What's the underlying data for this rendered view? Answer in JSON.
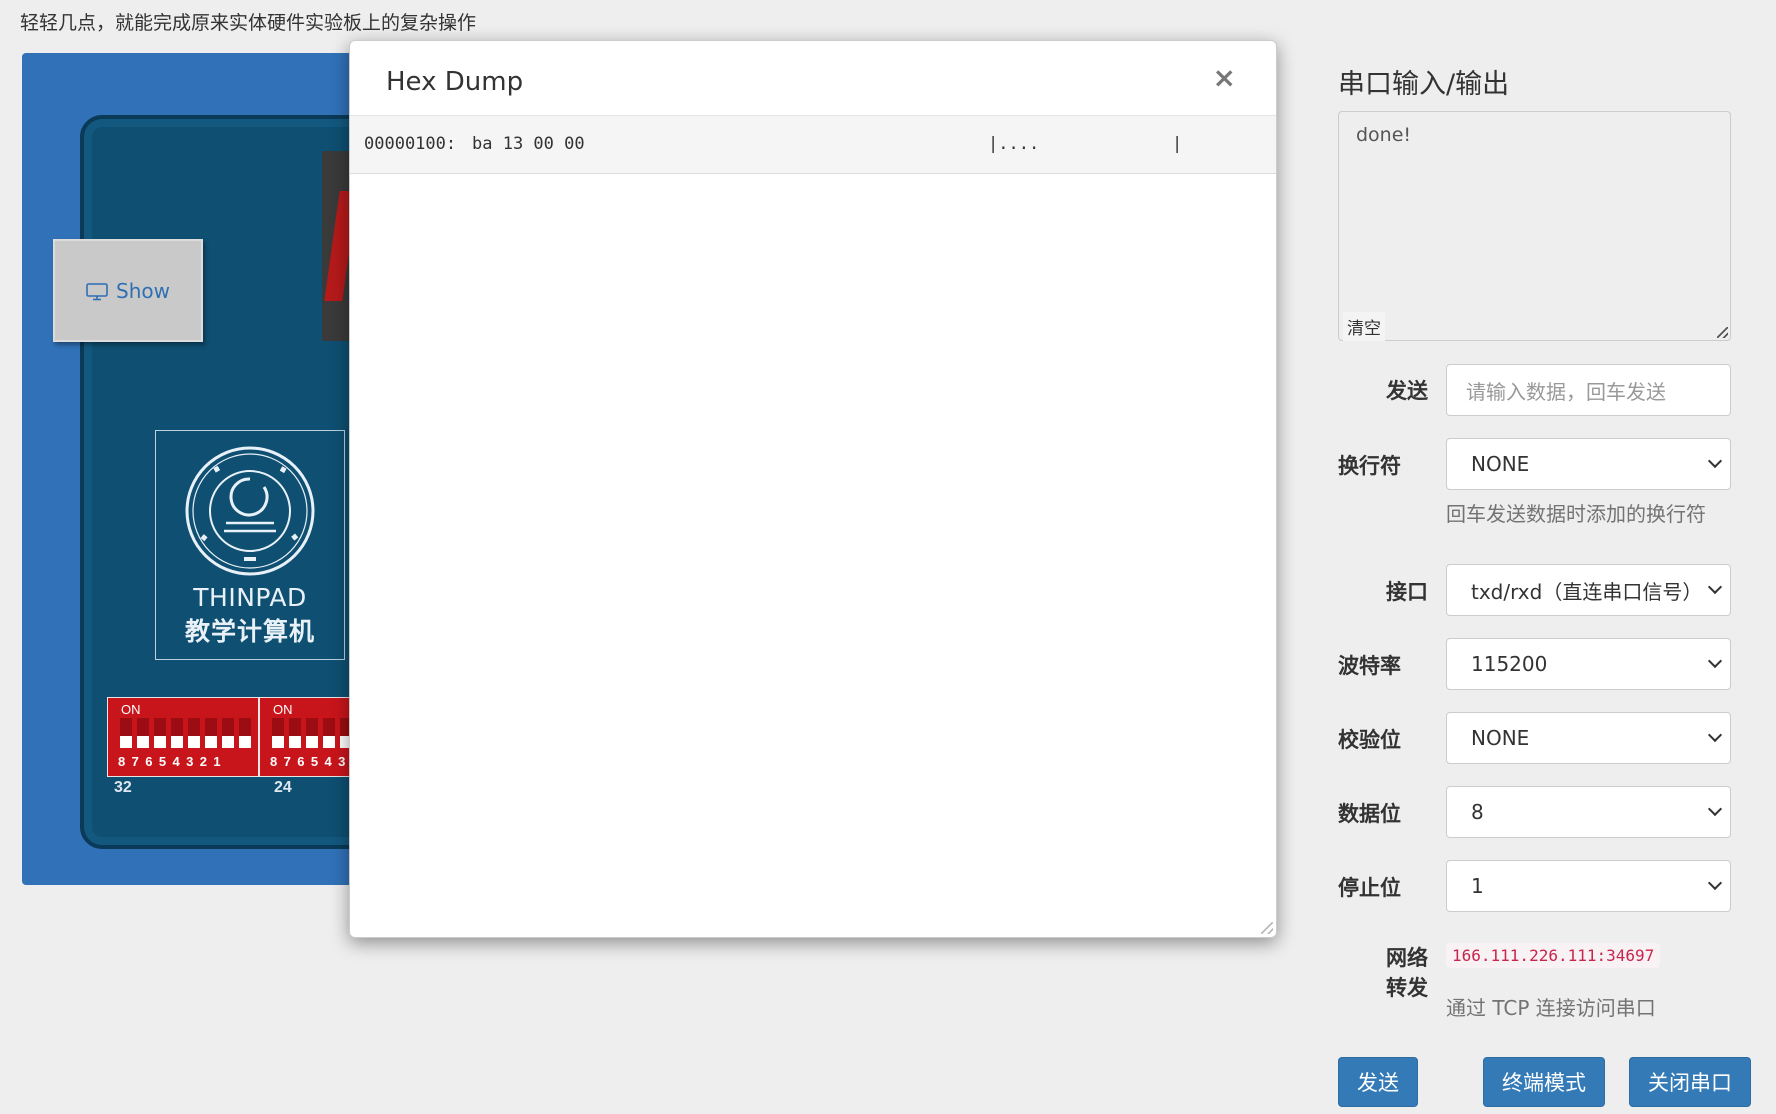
{
  "header": {
    "note": "轻轻几点，就能完成原来实体硬件实验板上的复杂操作"
  },
  "board": {
    "show_label": "Show",
    "logo_title": "THINPAD",
    "logo_subtitle": "教学计算机",
    "dip_on": "ON",
    "dip_numbers": "87654321",
    "dip_labels": [
      "32",
      "24"
    ]
  },
  "modal": {
    "title": "Hex Dump",
    "close_label": "×",
    "rows": [
      {
        "offset": "00000100:",
        "hex": "ba 13 00 00",
        "ascii": "|....",
        "end": "|"
      }
    ]
  },
  "serial": {
    "title": "串口输入/输出",
    "output": "done!",
    "clear_label": "清空",
    "send_label": "发送",
    "send_placeholder": "请输入数据，回车发送",
    "newline_label": "换行符",
    "newline_value": "NONE",
    "newline_help": "回车发送数据时添加的换行符",
    "interface_label": "接口",
    "interface_value": "txd/rxd（直连串口信号）",
    "baud_label": "波特率",
    "baud_value": "115200",
    "parity_label": "校验位",
    "parity_value": "NONE",
    "databits_label": "数据位",
    "databits_value": "8",
    "stopbits_label": "停止位",
    "stopbits_value": "1",
    "forward_label_1": "网络",
    "forward_label_2": "转发",
    "forward_address": "166.111.226.111:34697",
    "forward_help": "通过 TCP 连接访问串口",
    "buttons": {
      "send": "发送",
      "terminal": "终端模式",
      "close": "关闭串口"
    }
  },
  "colors": {
    "primary": "#337ab7",
    "board_blue": "#3171b8",
    "pcb": "#0e4f72",
    "dip_red": "#c8151b",
    "code_red": "#c7254e"
  }
}
